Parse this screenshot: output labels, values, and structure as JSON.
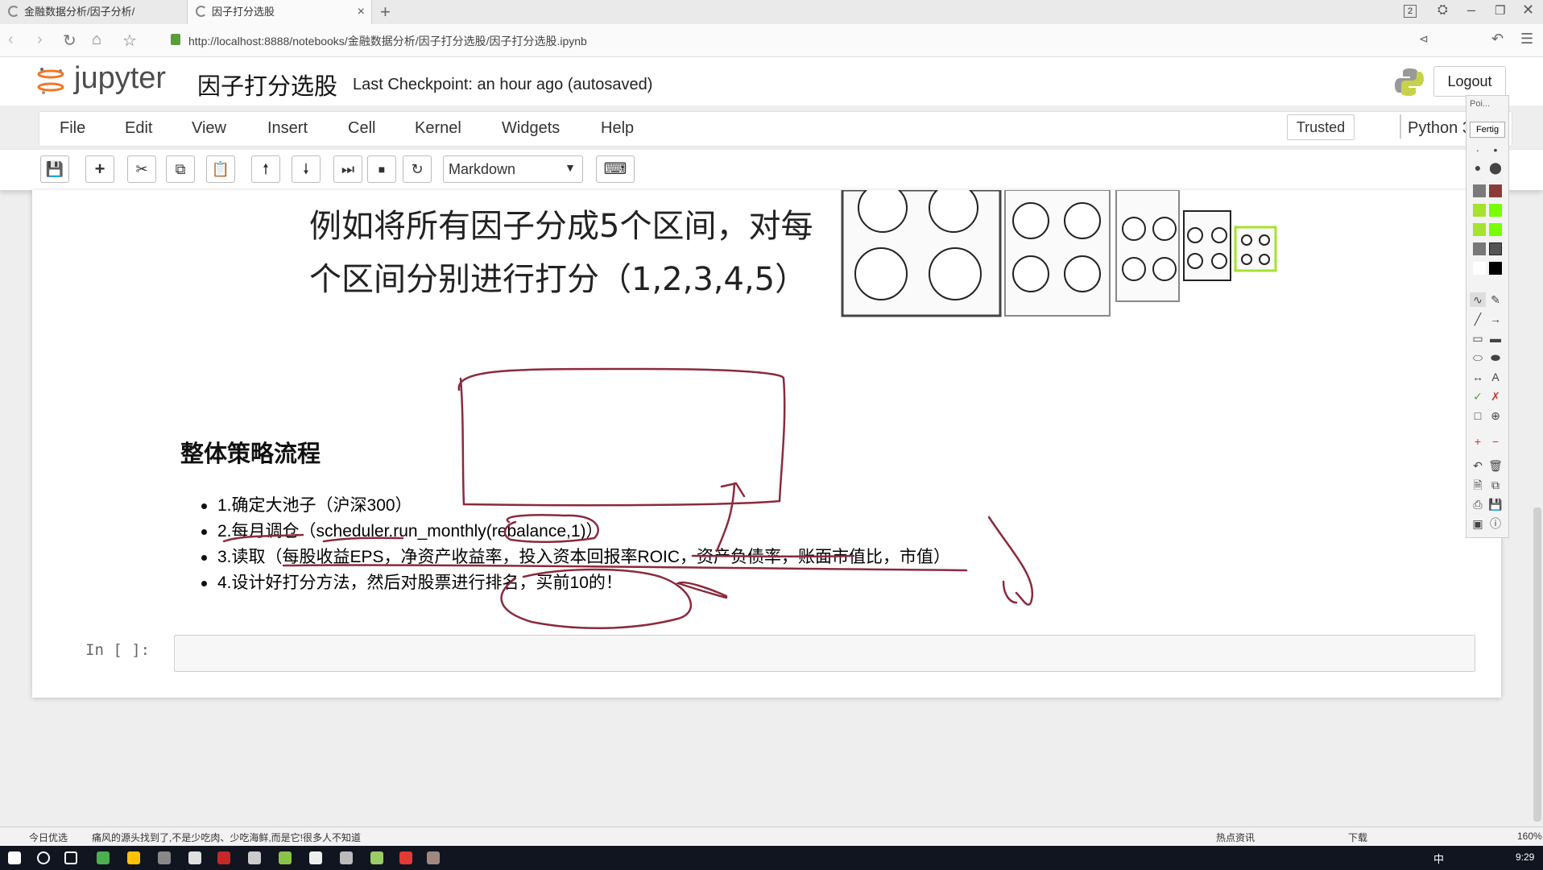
{
  "browser": {
    "tabs": [
      {
        "label": "金融数据分析/因子分析/"
      },
      {
        "label": "因子打分选股"
      }
    ],
    "close_glyph": "×",
    "new_tab_glyph": "+",
    "badge": "2",
    "url": "http://localhost:8888/notebooks/金融数据分析/因子打分选股/因子打分选股.ipynb"
  },
  "jupyter": {
    "logo_text": "jupyter",
    "notebook_title": "因子打分选股",
    "checkpoint": "Last Checkpoint: an hour ago (autosaved)",
    "logout": "Logout",
    "menu": [
      "File",
      "Edit",
      "View",
      "Insert",
      "Cell",
      "Kernel",
      "Widgets",
      "Help"
    ],
    "trusted": "Trusted",
    "kernel": "Python 3",
    "cell_type": "Markdown"
  },
  "content": {
    "line1": "例如将所有因子分成5个区间，对每",
    "line2": "个区间分别进行打分（1,2,3,4,5）",
    "heading": "整体策略流程",
    "bullets": [
      "1.确定大池子（沪深300）",
      "2.每月调仓（scheduler.run_monthly(rebalance,1)）",
      "3.读取（每股收益EPS，净资产收益率，投入资本回报率ROIC，资产负债率，账面市值比，市值）",
      "4.设计好打分方法，然后对股票进行排名，买前10的！"
    ],
    "prompt": "In [ ]:"
  },
  "pen_panel": {
    "header": "Poi...",
    "mode": "Fertig",
    "colors": [
      "#7a7a7a",
      "#8b3a3a",
      "#a6e22e",
      "#77ff00",
      "#777777",
      "#555555",
      "#ffffff",
      "#000000"
    ]
  },
  "statusbar": {
    "left": "今日优选",
    "news": "痛风的源头找到了,不是少吃肉、少吃海鲜,而是它!很多人不知道",
    "hot": "热点资讯",
    "download": "下载",
    "zoom": "160%"
  },
  "taskbar": {
    "ime": "中",
    "clock": "9:29"
  }
}
